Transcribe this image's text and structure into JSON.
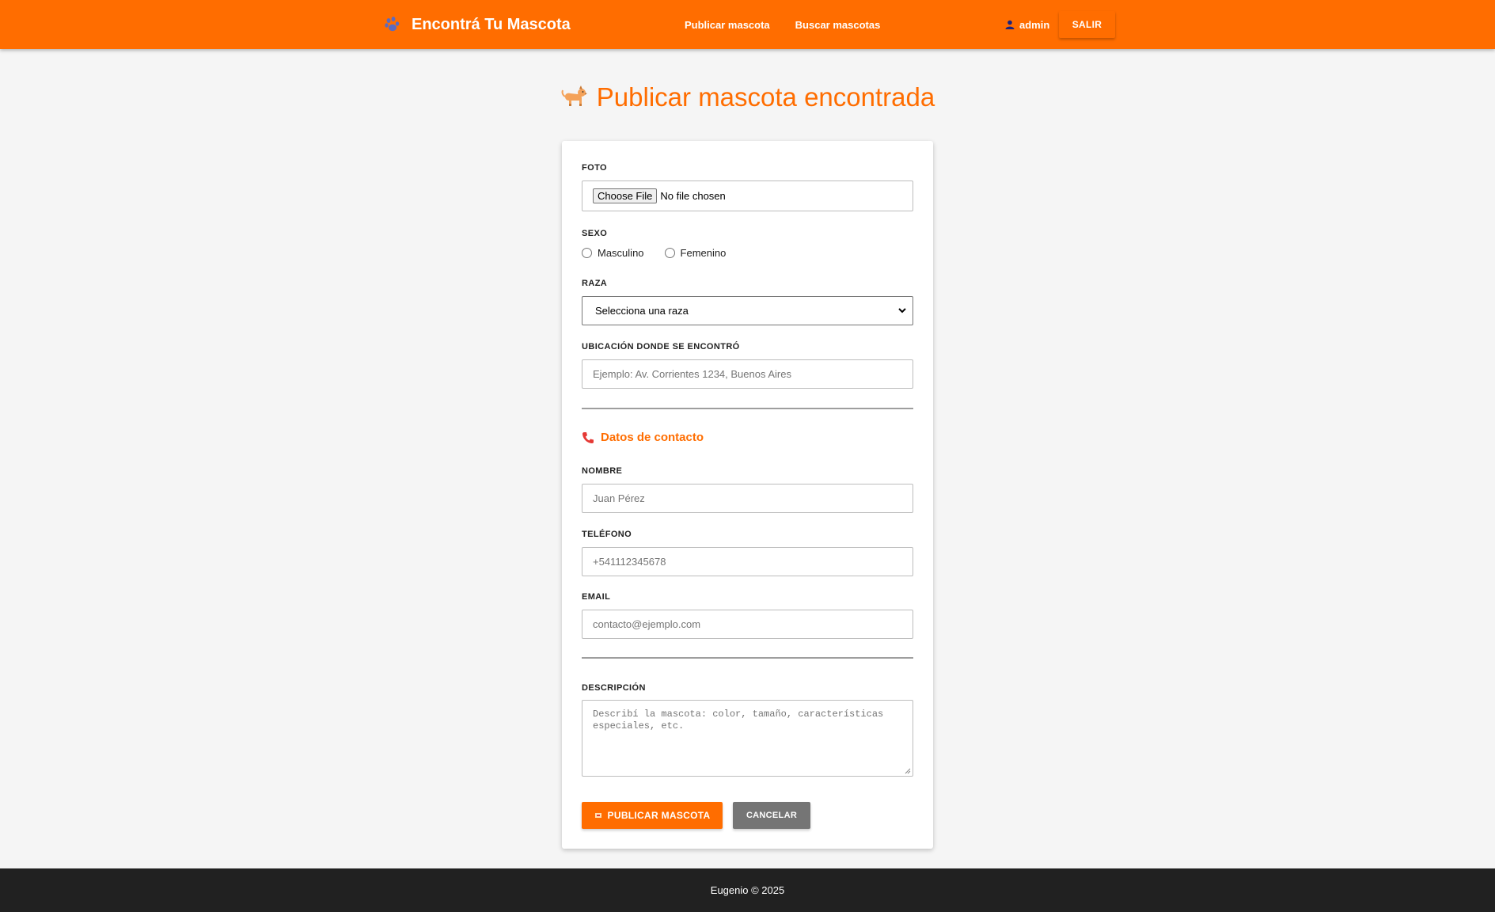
{
  "navbar": {
    "brand": "Encontrá Tu Mascota",
    "links": [
      "Publicar mascota",
      "Buscar mascotas"
    ],
    "username": "admin",
    "logout_label": "SALIR",
    "accent_color": "#ff6d00"
  },
  "page": {
    "title": "Publicar mascota encontrada"
  },
  "form": {
    "foto": {
      "label": "FOTO",
      "button": "Choose File",
      "status": "No file chosen"
    },
    "sexo": {
      "label": "SEXO",
      "options": [
        "Masculino",
        "Femenino"
      ]
    },
    "raza": {
      "label": "RAZA",
      "selected": "Selecciona una raza"
    },
    "ubicacion": {
      "label": "UBICACIÓN DONDE SE ENCONTRÓ",
      "placeholder": "Ejemplo: Av. Corrientes 1234, Buenos Aires"
    },
    "contacto": {
      "title": "Datos de contacto",
      "nombre_label": "NOMBRE",
      "nombre_placeholder": "Juan Pérez",
      "telefono_label": "TELÉFONO",
      "telefono_placeholder": "+541112345678",
      "email_label": "EMAIL",
      "email_placeholder": "contacto@ejemplo.com"
    },
    "descripcion": {
      "label": "DESCRIPCIÓN",
      "placeholder": "Describí la mascota: color, tamaño, características especiales, etc."
    },
    "submit_label": "PUBLICAR MASCOTA",
    "cancel_label": "CANCELAR"
  },
  "footer": {
    "text": "Eugenio © 2025"
  }
}
